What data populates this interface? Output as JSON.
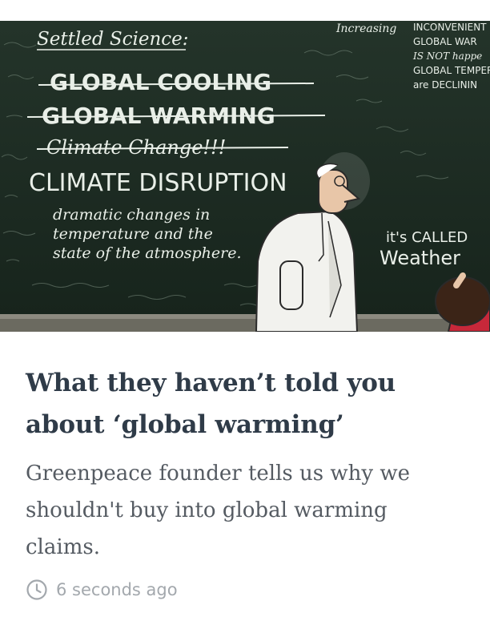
{
  "article": {
    "image": {
      "board": {
        "title": "Settled Science:",
        "struck": [
          "GLOBAL COOLING",
          "GLOBAL WARMING",
          "Climate Change!!!"
        ],
        "current": "CLIMATE DISRUPTION",
        "definition_lines": [
          "dramatic changes in",
          "temperature and the",
          "state of the atmosphere."
        ],
        "right_top_lines": [
          "INCONVENIENT",
          "GLOBAL WAR",
          "IS NOT happe",
          "GLOBAL TEMPER",
          "are DECLININ"
        ],
        "kid_lines": [
          "it's CALLED",
          "Weather"
        ],
        "top_fragment": "Increasing"
      }
    },
    "headline_lines": [
      "What they haven’t told you",
      "about ‘global warming’"
    ],
    "summary_lines": [
      "Greenpeace founder tells us why we",
      "shouldn't buy into global warming",
      "claims."
    ],
    "timestamp": "6 seconds ago",
    "icons": {
      "clock": "clock-icon"
    },
    "colors": {
      "headline": "#2f3b48",
      "summary": "#555b62",
      "meta": "#a3a8ad",
      "chalkboard": "#1d2b22"
    }
  }
}
